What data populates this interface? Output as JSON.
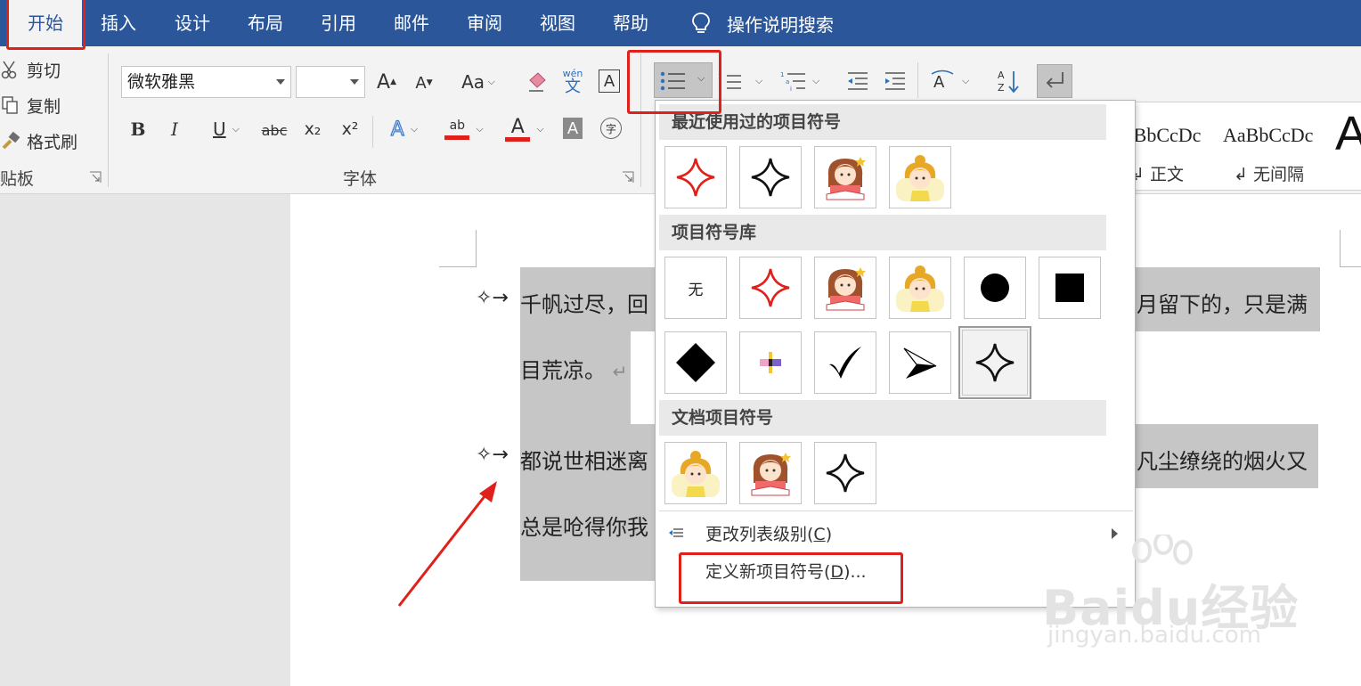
{
  "tabs": [
    {
      "label": "开始",
      "active": true
    },
    {
      "label": "插入"
    },
    {
      "label": "设计"
    },
    {
      "label": "布局"
    },
    {
      "label": "引用"
    },
    {
      "label": "邮件"
    },
    {
      "label": "审阅"
    },
    {
      "label": "视图"
    },
    {
      "label": "帮助"
    }
  ],
  "tell_me": {
    "label": "操作说明搜索",
    "icon": "lightbulb-icon"
  },
  "clipboard": {
    "cut": "剪切",
    "copy": "复制",
    "format_painter": "格式刷",
    "group_label": "贴板"
  },
  "font": {
    "font_name": "微软雅黑",
    "font_size": "",
    "group_label": "字体",
    "change_case": "Aa",
    "phonetic_top": "wén",
    "phonetic_bottom": "文",
    "char_border": "A",
    "bold": "B",
    "italic": "I",
    "underline": "U",
    "strike": "abc",
    "subscript": "x₂",
    "superscript": "x²",
    "text_effect": "A",
    "highlight": "ab",
    "font_color": "A",
    "char_shading": "A",
    "enclose": "字"
  },
  "styles": [
    {
      "sample": "AaBbCcDc",
      "name": "正文"
    },
    {
      "sample": "AaBbCcDc",
      "name": "无间隔"
    }
  ],
  "document": {
    "para1_bullet": "✧→",
    "para1_line1_left": "千帆过尽，回",
    "para1_line1_right": "月留下的，只是满",
    "para1_line2": "目荒凉。",
    "para_mark": "↵",
    "para2_bullet": "✧→",
    "para2_line1_left": "都说世相迷离",
    "para2_line1_right": "凡尘缭绕的烟火又",
    "para2_line2": "总是呛得你我"
  },
  "bullet_menu": {
    "recent_header": "最近使用过的项目符号",
    "library_header": "项目符号库",
    "document_header": "文档项目符号",
    "none_label": "无",
    "change_level": "更改列表级别(C)",
    "change_level_text": "更改列表级别(",
    "change_level_key": "C",
    "change_level_close": ")",
    "define_text": "定义新项目符号(",
    "define_key": "D",
    "define_close": ")...",
    "recent": [
      "red-four-point-star-icon",
      "black-four-point-star-icon",
      "girl-reading-icon",
      "girl-avatar-icon"
    ],
    "library_row1": [
      "none",
      "red-four-point-star-icon",
      "girl-reading-icon",
      "girl-avatar-icon",
      "filled-circle-icon",
      "filled-square-icon"
    ],
    "library_row2": [
      "filled-diamond-icon",
      "color-cross-icon",
      "checkmark-icon",
      "arrowhead-icon",
      "black-four-point-star-icon"
    ],
    "document_bullets": [
      "girl-avatar-icon",
      "girl-reading-icon",
      "black-four-point-star-icon"
    ]
  },
  "watermark": {
    "brand": "Baidu经验",
    "url": "jingyan.baidu.com"
  },
  "colors": {
    "title_bar": "#2b579a",
    "highlight_red": "#e0201a",
    "selection": "#c6c6c6"
  }
}
